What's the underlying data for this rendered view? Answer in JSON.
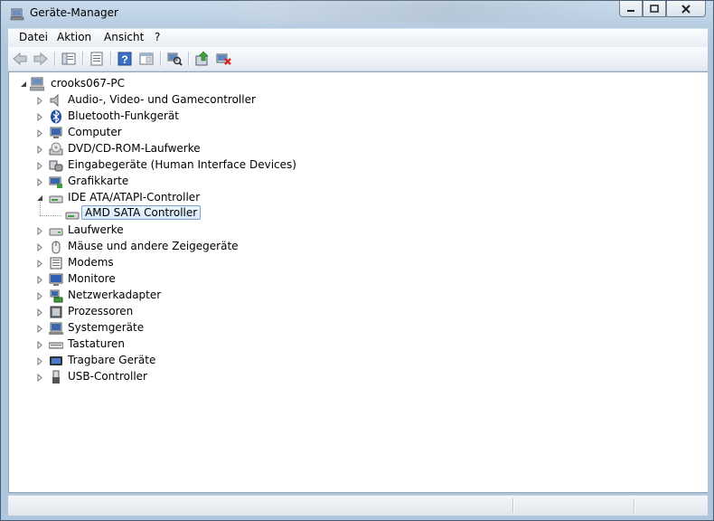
{
  "window": {
    "title": "Geräte-Manager",
    "icon": "device-manager-icon"
  },
  "menu": {
    "items": [
      "Datei",
      "Aktion",
      "Ansicht",
      "?"
    ]
  },
  "toolbar": {
    "buttons": [
      "back-arrow-icon",
      "forward-arrow-icon",
      "console-tree-icon",
      "properties-icon",
      "help-icon",
      "view-icon",
      "scan-hardware-icon",
      "update-driver-icon",
      "uninstall-icon"
    ]
  },
  "tree": {
    "root": "crooks067-PC",
    "categories": [
      {
        "label": "Audio-, Video- und Gamecontroller",
        "icon": "speaker-icon",
        "expanded": false
      },
      {
        "label": "Bluetooth-Funkgerät",
        "icon": "bluetooth-icon",
        "expanded": false
      },
      {
        "label": "Computer",
        "icon": "computer-icon",
        "expanded": false
      },
      {
        "label": "DVD/CD-ROM-Laufwerke",
        "icon": "dvd-drive-icon",
        "expanded": false
      },
      {
        "label": "Eingabegeräte (Human Interface Devices)",
        "icon": "hid-icon",
        "expanded": false
      },
      {
        "label": "Grafikkarte",
        "icon": "display-adapter-icon",
        "expanded": false
      },
      {
        "label": "IDE ATA/ATAPI-Controller",
        "icon": "ide-controller-icon",
        "expanded": true,
        "children": [
          {
            "label": "AMD SATA Controller",
            "icon": "ide-controller-icon",
            "selected": true
          }
        ]
      },
      {
        "label": "Laufwerke",
        "icon": "disk-drive-icon",
        "expanded": false
      },
      {
        "label": "Mäuse und andere Zeigegeräte",
        "icon": "mouse-icon",
        "expanded": false
      },
      {
        "label": "Modems",
        "icon": "modem-icon",
        "expanded": false
      },
      {
        "label": "Monitore",
        "icon": "monitor-icon",
        "expanded": false
      },
      {
        "label": "Netzwerkadapter",
        "icon": "network-adapter-icon",
        "expanded": false
      },
      {
        "label": "Prozessoren",
        "icon": "processor-icon",
        "expanded": false
      },
      {
        "label": "Systemgeräte",
        "icon": "system-devices-icon",
        "expanded": false
      },
      {
        "label": "Tastaturen",
        "icon": "keyboard-icon",
        "expanded": false
      },
      {
        "label": "Tragbare Geräte",
        "icon": "portable-devices-icon",
        "expanded": false
      },
      {
        "label": "USB-Controller",
        "icon": "usb-icon",
        "expanded": false
      }
    ]
  },
  "colors": {
    "selection_border": "#7da2ce",
    "selection_fill": "#dcecfc",
    "window_frame": "#aec6de"
  }
}
